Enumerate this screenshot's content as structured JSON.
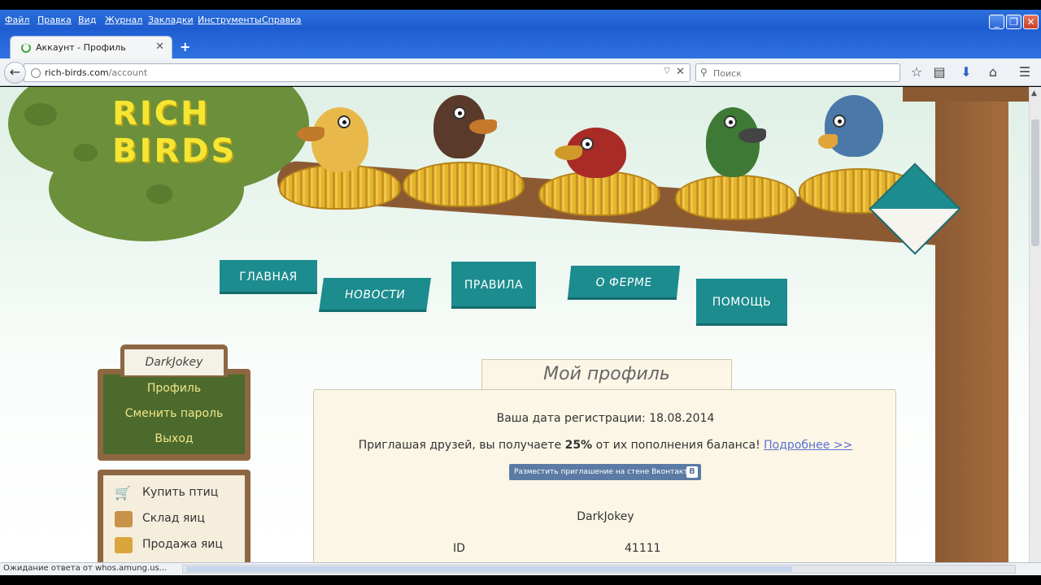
{
  "browser": {
    "menu": [
      "Файл",
      "Правка",
      "Вид",
      "Журнал",
      "Закладки",
      "Инструменты",
      "Справка"
    ],
    "tab_title": "Аккаунт - Профиль",
    "url_host": "rich-birds.com",
    "url_path": "/account",
    "search_placeholder": "Поиск",
    "status_text": "Ожидание ответа от whos.amung.us..."
  },
  "site": {
    "logo_line1": "RICH",
    "logo_line2": "BIRDS",
    "nav": [
      "ГЛАВНАЯ",
      "НОВОСТИ",
      "ПРАВИЛА",
      "О ФЕРМЕ",
      "ПОМОЩЬ"
    ],
    "accent_color": "#1c8c8e"
  },
  "user_menu": {
    "username": "DarkJokey",
    "items": [
      "Профиль",
      "Сменить пароль",
      "Выход"
    ]
  },
  "shop_menu": {
    "items": [
      "Купить птиц",
      "Склад яиц",
      "Продажа яиц"
    ]
  },
  "profile": {
    "title": "Мой профиль",
    "reg_text": "Ваша дата регистрации: 18.08.2014",
    "invite_pre": "Приглашая друзей, вы получаете",
    "invite_bold": "25%",
    "invite_post": "от их пополнения баланса!",
    "invite_link": "Подробнее >>",
    "vk_button": "Разместить приглашение на стене Вконтакте",
    "vk_badge": "B",
    "username": "DarkJokey",
    "id_label": "ID",
    "id_value": "41111"
  }
}
